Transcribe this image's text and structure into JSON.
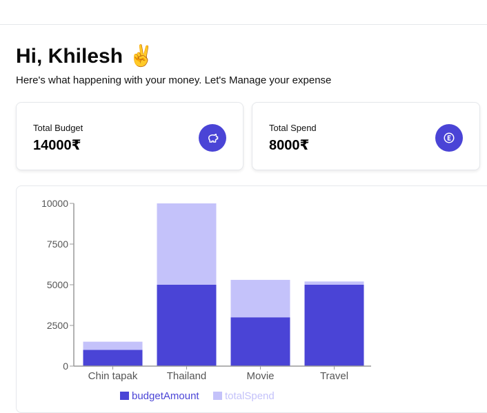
{
  "header": {
    "greeting": "Hi, Khilesh ✌️",
    "subtitle": "Here's what happening with your money. Let's Manage your expense"
  },
  "cards": [
    {
      "label": "Total Budget",
      "value": "14000₹",
      "icon": "piggy-bank-icon"
    },
    {
      "label": "Total Spend",
      "value": "8000₹",
      "icon": "coin-icon"
    }
  ],
  "colors": {
    "accent": "#4a44d6",
    "budget": "#4a44d6",
    "spend": "#c4c2fa"
  },
  "chart_data": {
    "type": "bar",
    "stacked": true,
    "categories": [
      "Chin tapak",
      "Thailand",
      "Movie",
      "Travel"
    ],
    "series": [
      {
        "name": "budgetAmount",
        "values": [
          1000,
          5000,
          3000,
          5000
        ]
      },
      {
        "name": "totalSpend",
        "values": [
          500,
          5000,
          2300,
          200
        ]
      }
    ],
    "yticks": [
      0,
      2500,
      5000,
      7500,
      10000
    ],
    "ylim": [
      0,
      10000
    ],
    "grid": false,
    "legend": "bottom"
  }
}
